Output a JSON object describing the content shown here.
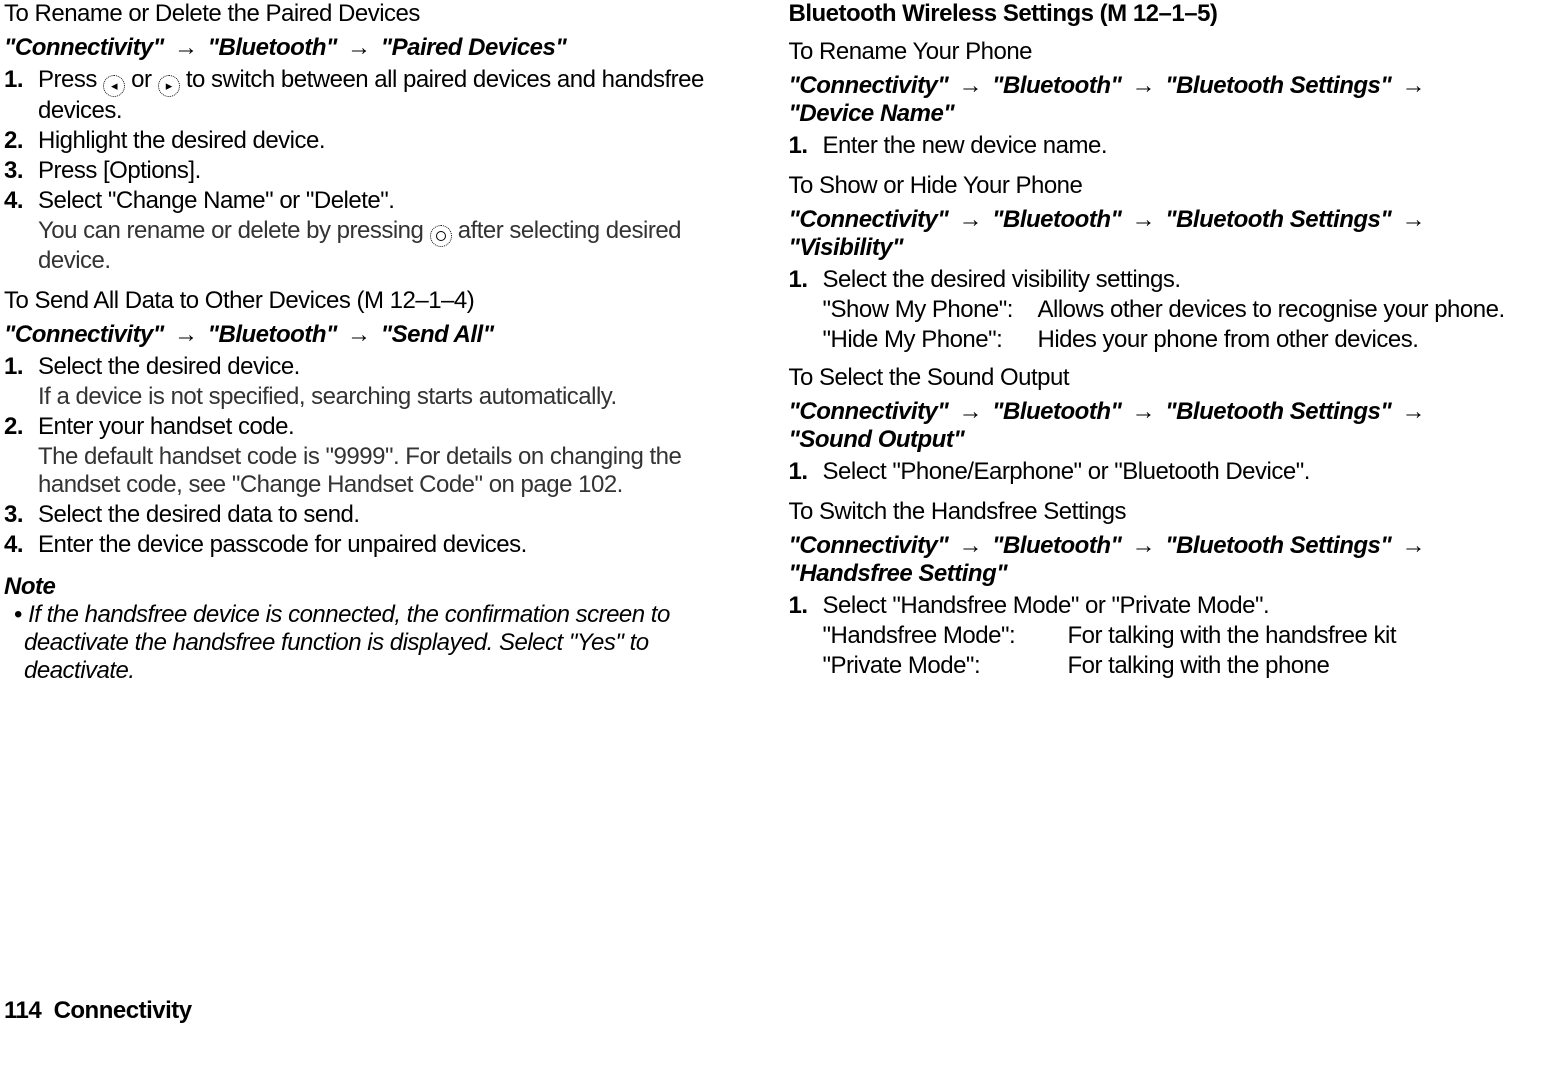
{
  "left": {
    "heading1": "To Rename or Delete the Paired Devices",
    "bc1": {
      "a": "\"Connectivity\"",
      "b": "\"Bluetooth\"",
      "c": "\"Paired Devices\""
    },
    "steps1": {
      "n1": "1.",
      "t1a": "Press ",
      "t1b": " or ",
      "t1c": " to switch between all paired devices and handsfree devices.",
      "n2": "2.",
      "t2": "Highlight the desired device.",
      "n3": "3.",
      "t3": "Press [Options].",
      "n4": "4.",
      "t4": "Select \"Change Name\" or \"Delete\".",
      "t4s_a": "You can rename or delete by pressing ",
      "t4s_b": " after selecting desired device."
    },
    "heading2_a": "To Send All Data to Other Devices ",
    "heading2_m": "(M 12–1–4)",
    "bc2": {
      "a": "\"Connectivity\"",
      "b": "\"Bluetooth\"",
      "c": "\"Send All\""
    },
    "steps2": {
      "n1": "1.",
      "t1": "Select the desired device.",
      "t1s": "If a device is not specified, searching starts automatically.",
      "n2": "2.",
      "t2": "Enter your handset code.",
      "t2s": "The default handset code is \"9999\". For details on changing the handset code, see \"Change Handset Code\" on page 102.",
      "n3": "3.",
      "t3": "Select the desired data to send.",
      "n4": "4.",
      "t4": "Enter the device passcode for unpaired devices."
    },
    "noteHead": "Note",
    "noteBody": "If the handsfree device is connected, the confirmation screen to deactivate the handsfree function is displayed. Select \"Yes\" to deactivate."
  },
  "right": {
    "headingTop_a": "Bluetooth Wireless Settings ",
    "headingTop_m": "(M 12–1–5)",
    "sub1": "To Rename Your Phone",
    "bc1": {
      "a": "\"Connectivity\"",
      "b": "\"Bluetooth\"",
      "c": "\"Bluetooth Settings\"",
      "d": "\"Device Name\""
    },
    "s1": {
      "n1": "1.",
      "t1": "Enter the new device name."
    },
    "sub2": "To Show or Hide Your Phone",
    "bc2": {
      "a": "\"Connectivity\"",
      "b": "\"Bluetooth\"",
      "c": "\"Bluetooth Settings\"",
      "d": "\"Visibility\""
    },
    "s2": {
      "n1": "1.",
      "t1": "Select the desired visibility settings."
    },
    "d2": {
      "term1": "\"Show My Phone\":",
      "desc1": "Allows other devices to recognise your phone.",
      "term2": "\"Hide My Phone\":",
      "desc2": "Hides your phone from other devices."
    },
    "sub3": "To Select the Sound Output",
    "bc3": {
      "a": "\"Connectivity\"",
      "b": "\"Bluetooth\"",
      "c": "\"Bluetooth Settings\"",
      "d": "\"Sound Output\""
    },
    "s3": {
      "n1": "1.",
      "t1": "Select \"Phone/Earphone\" or \"Bluetooth Device\"."
    },
    "sub4": "To Switch the Handsfree Settings",
    "bc4": {
      "a": "\"Connectivity\"",
      "b": "\"Bluetooth\"",
      "c": "\"Bluetooth Settings\"",
      "d": "\"Handsfree Setting\""
    },
    "s4": {
      "n1": "1.",
      "t1": "Select \"Handsfree Mode\" or \"Private Mode\"."
    },
    "d4": {
      "term1": "\"Handsfree Mode\":",
      "desc1": "For talking with the handsfree kit",
      "term2": "\"Private Mode\":",
      "desc2": "For talking with the phone"
    }
  },
  "footer": {
    "page": "114",
    "section": "Connectivity"
  },
  "arrow": "→"
}
